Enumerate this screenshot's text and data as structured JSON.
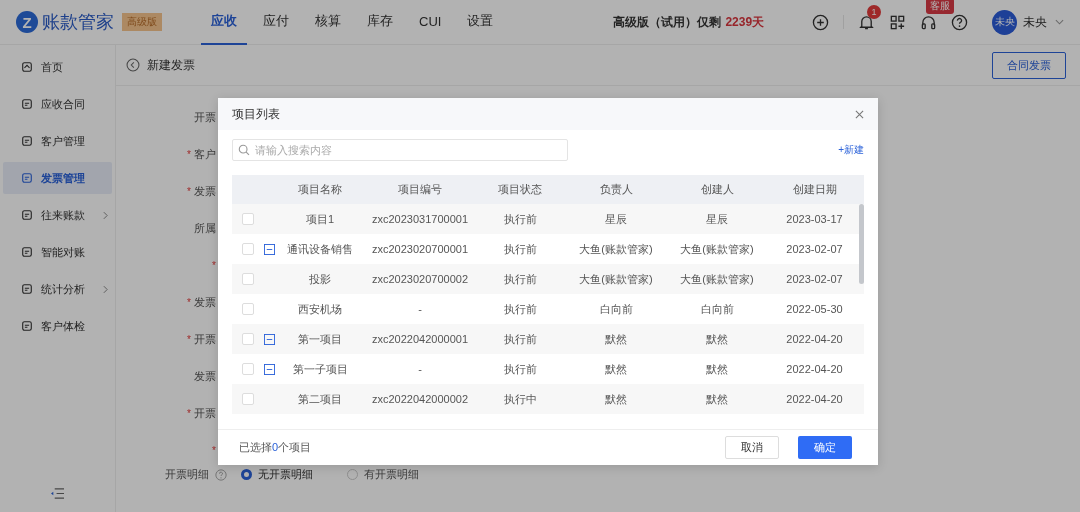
{
  "header": {
    "logo_mark": "Z",
    "logo_text": "账款管家",
    "edition_badge": "高级版",
    "nav": [
      {
        "label": "应收",
        "selected": true
      },
      {
        "label": "应付",
        "selected": false
      },
      {
        "label": "核算",
        "selected": false
      },
      {
        "label": "库存",
        "selected": false
      },
      {
        "label": "CUI",
        "selected": false
      },
      {
        "label": "设置",
        "selected": false
      }
    ],
    "trial_text": "高级版（试用）仅剩",
    "trial_days": "2239天",
    "notification_count": "1",
    "service_badge": "客服",
    "avatar_text": "未央",
    "user_name": "未央"
  },
  "sidebar": {
    "items": [
      {
        "label": "首页",
        "selected": false,
        "expandable": false
      },
      {
        "label": "应收合同",
        "selected": false,
        "expandable": false
      },
      {
        "label": "客户管理",
        "selected": false,
        "expandable": false
      },
      {
        "label": "发票管理",
        "selected": true,
        "expandable": false
      },
      {
        "label": "往来账款",
        "selected": false,
        "expandable": true
      },
      {
        "label": "智能对账",
        "selected": false,
        "expandable": false
      },
      {
        "label": "统计分析",
        "selected": false,
        "expandable": true
      },
      {
        "label": "客户体检",
        "selected": false,
        "expandable": false
      }
    ]
  },
  "page": {
    "title": "新建发票",
    "contract_button": "合同发票",
    "form_labels": [
      {
        "label": "开票"
      },
      {
        "mark": "*",
        "label": "客户"
      },
      {
        "mark": "*",
        "label": "发票"
      },
      {
        "label": "所属"
      },
      {
        "mark": "*"
      },
      {
        "mark": "*",
        "label": "发票"
      },
      {
        "mark": "*",
        "label": "开票"
      },
      {
        "label": "发票"
      },
      {
        "mark": "*",
        "label": "开票"
      },
      {
        "mark": "*"
      }
    ],
    "detail_label": "开票明细",
    "detail_options": [
      {
        "label": "无开票明细",
        "selected": true
      },
      {
        "label": "有开票明细",
        "selected": false
      }
    ]
  },
  "dialog": {
    "title": "项目列表",
    "search": {
      "placeholder": "请输入搜索内容"
    },
    "new_link": "+新建",
    "table": {
      "columns": [
        "项目名称",
        "项目编号",
        "项目状态",
        "负责人",
        "创建人",
        "创建日期"
      ],
      "rows": [
        {
          "checked": false,
          "has_children": false,
          "cells": [
            "项目1",
            "zxc2023031700001",
            "执行前",
            "星辰",
            "星辰",
            "2023-03-17"
          ]
        },
        {
          "checked": false,
          "has_children": true,
          "cells": [
            "通讯设备销售",
            "zxc2023020700001",
            "执行前",
            "大鱼(账款管家)",
            "大鱼(账款管家)",
            "2023-02-07"
          ]
        },
        {
          "checked": false,
          "has_children": false,
          "cells": [
            "投影",
            "zxc2023020700002",
            "执行前",
            "大鱼(账款管家)",
            "大鱼(账款管家)",
            "2023-02-07"
          ]
        },
        {
          "checked": false,
          "has_children": false,
          "cells": [
            "西安机场",
            "-",
            "执行前",
            "白向前",
            "白向前",
            "2022-05-30"
          ]
        },
        {
          "checked": false,
          "has_children": true,
          "cells": [
            "第一项目",
            "zxc2022042000001",
            "执行前",
            "默然",
            "默然",
            "2022-04-20"
          ]
        },
        {
          "checked": false,
          "has_children": true,
          "cells": [
            "第一子项目",
            "-",
            "执行前",
            "默然",
            "默然",
            "2022-04-20"
          ]
        },
        {
          "checked": false,
          "has_children": false,
          "cells": [
            "第二项目",
            "zxc2022042000002",
            "执行中",
            "默然",
            "默然",
            "2022-04-20"
          ]
        }
      ]
    },
    "selection_prefix": "已选择",
    "selection_count": "0",
    "selection_suffix": "个项目",
    "cancel_button": "取消",
    "confirm_button": "确定"
  }
}
